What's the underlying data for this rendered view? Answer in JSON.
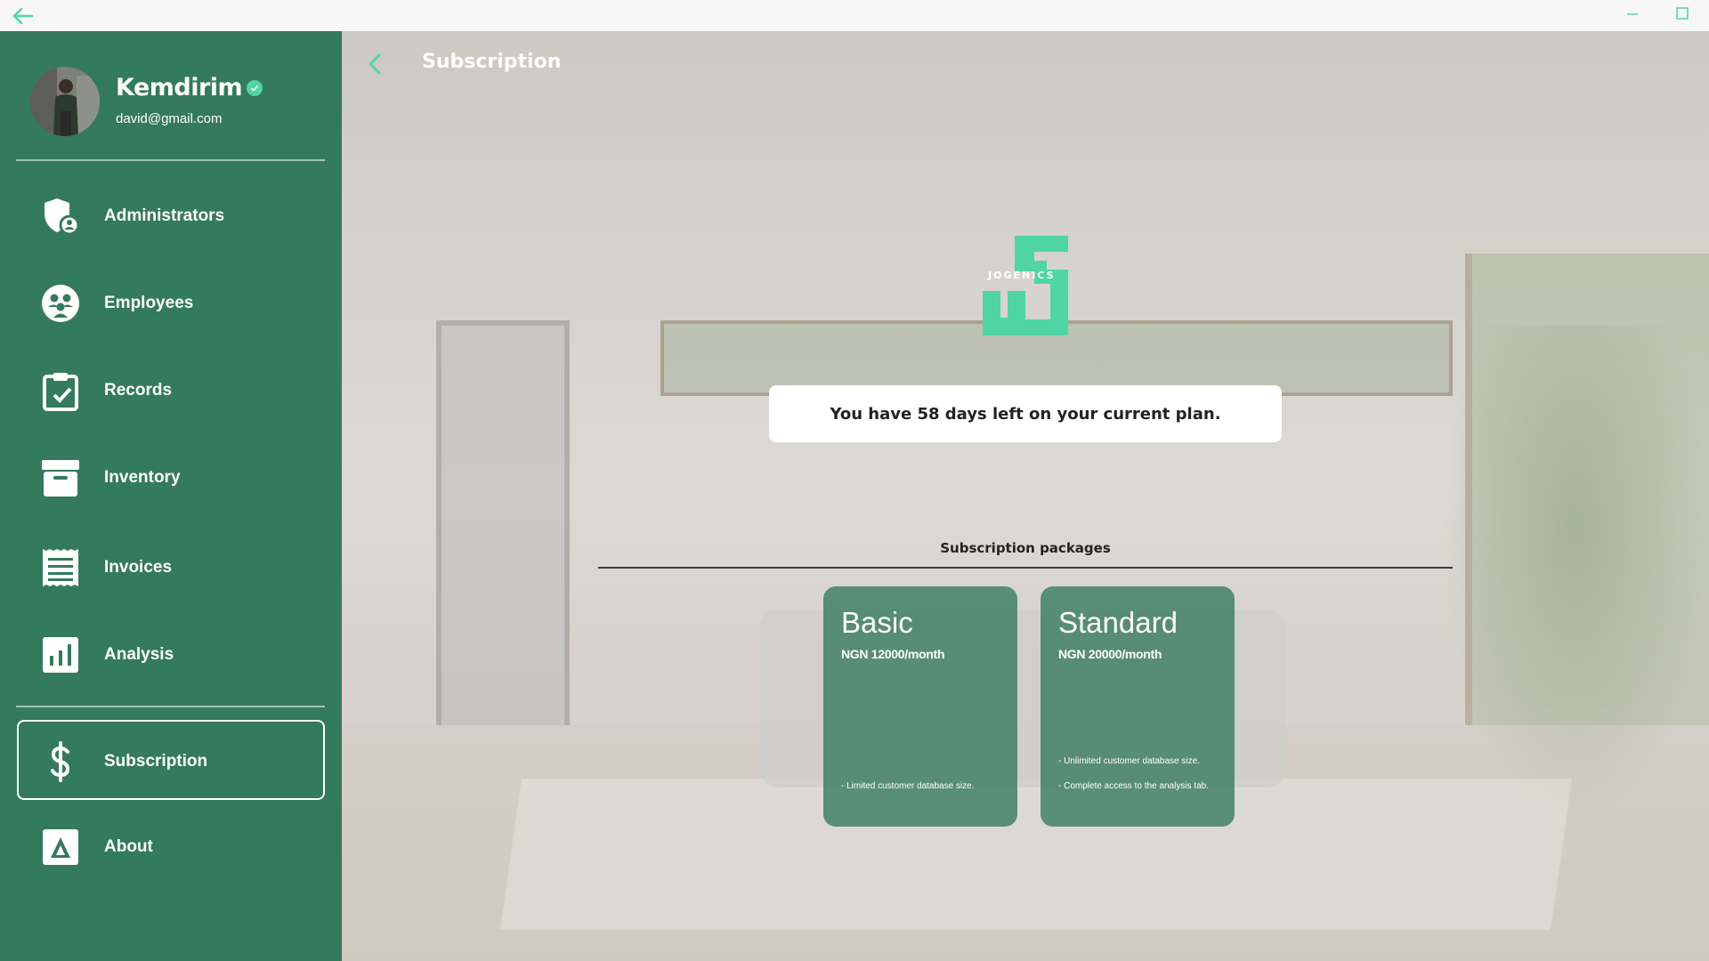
{
  "titlebar": {
    "back_icon": "arrow-left-icon",
    "minimize_icon": "minimize-icon",
    "maximize_icon": "maximize-icon"
  },
  "profile": {
    "name": "Kemdirim",
    "email": "david@gmail.com",
    "verified_icon": "verified-check-icon"
  },
  "sidebar": {
    "items": [
      {
        "label": "Administrators",
        "icon": "shield-user-icon"
      },
      {
        "label": "Employees",
        "icon": "people-icon"
      },
      {
        "label": "Records",
        "icon": "clipboard-check-icon"
      },
      {
        "label": "Inventory",
        "icon": "archive-box-icon"
      },
      {
        "label": "Invoices",
        "icon": "receipt-icon"
      },
      {
        "label": "Analysis",
        "icon": "bar-chart-icon"
      },
      {
        "label": "Subscription",
        "icon": "dollar-icon",
        "active": true
      },
      {
        "label": "About",
        "icon": "a-badge-icon"
      }
    ]
  },
  "header": {
    "title": "Subscription",
    "back_icon": "chevron-left-icon"
  },
  "logo": {
    "text": "JOGENICS",
    "color": "#4fd6a3"
  },
  "plan": {
    "message": "You have 58 days left on your current plan."
  },
  "packages": {
    "title": "Subscription packages",
    "cards": [
      {
        "name": "Basic",
        "price": "NGN 12000/month",
        "features": [
          "- Limited customer database size."
        ]
      },
      {
        "name": "Standard",
        "price": "NGN 20000/month",
        "features": [
          "- Unlimited customer database size.",
          "- Complete access to the analysis tab."
        ]
      }
    ]
  },
  "colors": {
    "sidebar": "#347a5d",
    "accent": "#4fd6a3",
    "card": "#347a5d"
  }
}
